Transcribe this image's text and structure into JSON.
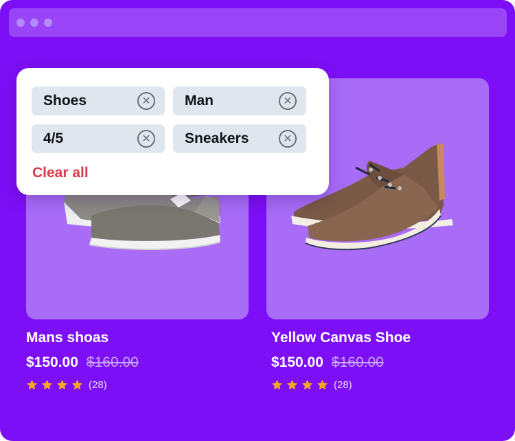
{
  "browser": {
    "window_dots": 3
  },
  "filters": {
    "chips": [
      {
        "label": "Shoes"
      },
      {
        "label": "Man"
      },
      {
        "label": "4/5"
      },
      {
        "label": "Sneakers"
      }
    ],
    "remove_icon": "circle-x-icon",
    "clear_all_label": "Clear all"
  },
  "products": [
    {
      "name": "Mans shoas",
      "price": "$150.00",
      "old_price": "$160.00",
      "rating": 4,
      "review_count": "(28)",
      "image": "gray-sneaker"
    },
    {
      "name": "Yellow Canvas Shoe",
      "price": "$150.00",
      "old_price": "$160.00",
      "rating": 4,
      "review_count": "(28)",
      "image": "brown-canvas-shoe"
    }
  ],
  "colors": {
    "background": "#7c0ff5",
    "card": "#a86cf6",
    "chip": "#dfe6ee",
    "clear_all": "#d83b4b",
    "star": "#f6a623"
  }
}
